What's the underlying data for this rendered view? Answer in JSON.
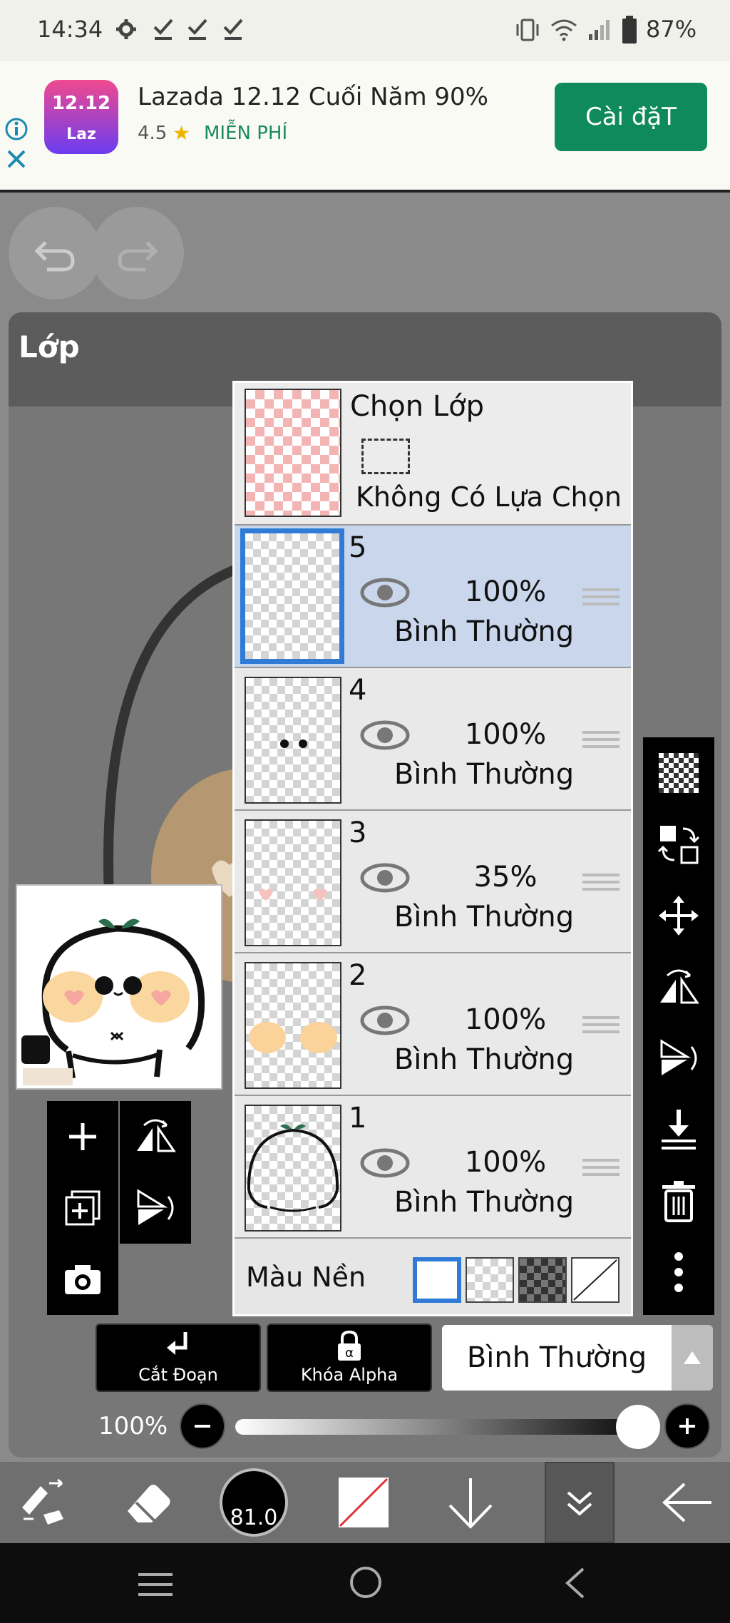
{
  "status_bar": {
    "time": "14:34",
    "battery": "87%",
    "icons": [
      "gear-icon",
      "check-icon",
      "check-icon",
      "check-icon",
      "vibrate-icon",
      "wifi-icon",
      "signal-icon",
      "battery-icon"
    ]
  },
  "ad": {
    "icon_label": "12.12",
    "icon_sub": "Laz",
    "title": "Lazada 12.12 Cuối Năm 90%",
    "rating": "4.5",
    "price": "MIỄN PHÍ",
    "install_label": "Cài đặT",
    "accent": "#0f8a5d"
  },
  "panel": {
    "title": "Lớp"
  },
  "selection": {
    "title": "Chọn Lớp",
    "status": "Không Có Lựa Chọn"
  },
  "layers": [
    {
      "num": "5",
      "opacity": "100%",
      "mode": "Bình Thường",
      "active": true
    },
    {
      "num": "4",
      "opacity": "100%",
      "mode": "Bình Thường",
      "active": false
    },
    {
      "num": "3",
      "opacity": "35%",
      "mode": "Bình Thường",
      "active": false
    },
    {
      "num": "2",
      "opacity": "100%",
      "mode": "Bình Thường",
      "active": false
    },
    {
      "num": "1",
      "opacity": "100%",
      "mode": "Bình Thường",
      "active": false
    }
  ],
  "background": {
    "label": "Màu Nền"
  },
  "bottom": {
    "clip_label": "Cắt Đoạn",
    "alpha_label": "Khóa Alpha",
    "blend_mode": "Bình Thường",
    "opacity_label": "100%",
    "brush_size": "81.0"
  },
  "colors": {
    "active_layer": "#c9d6ec",
    "selected_border": "#2f7bd6"
  }
}
